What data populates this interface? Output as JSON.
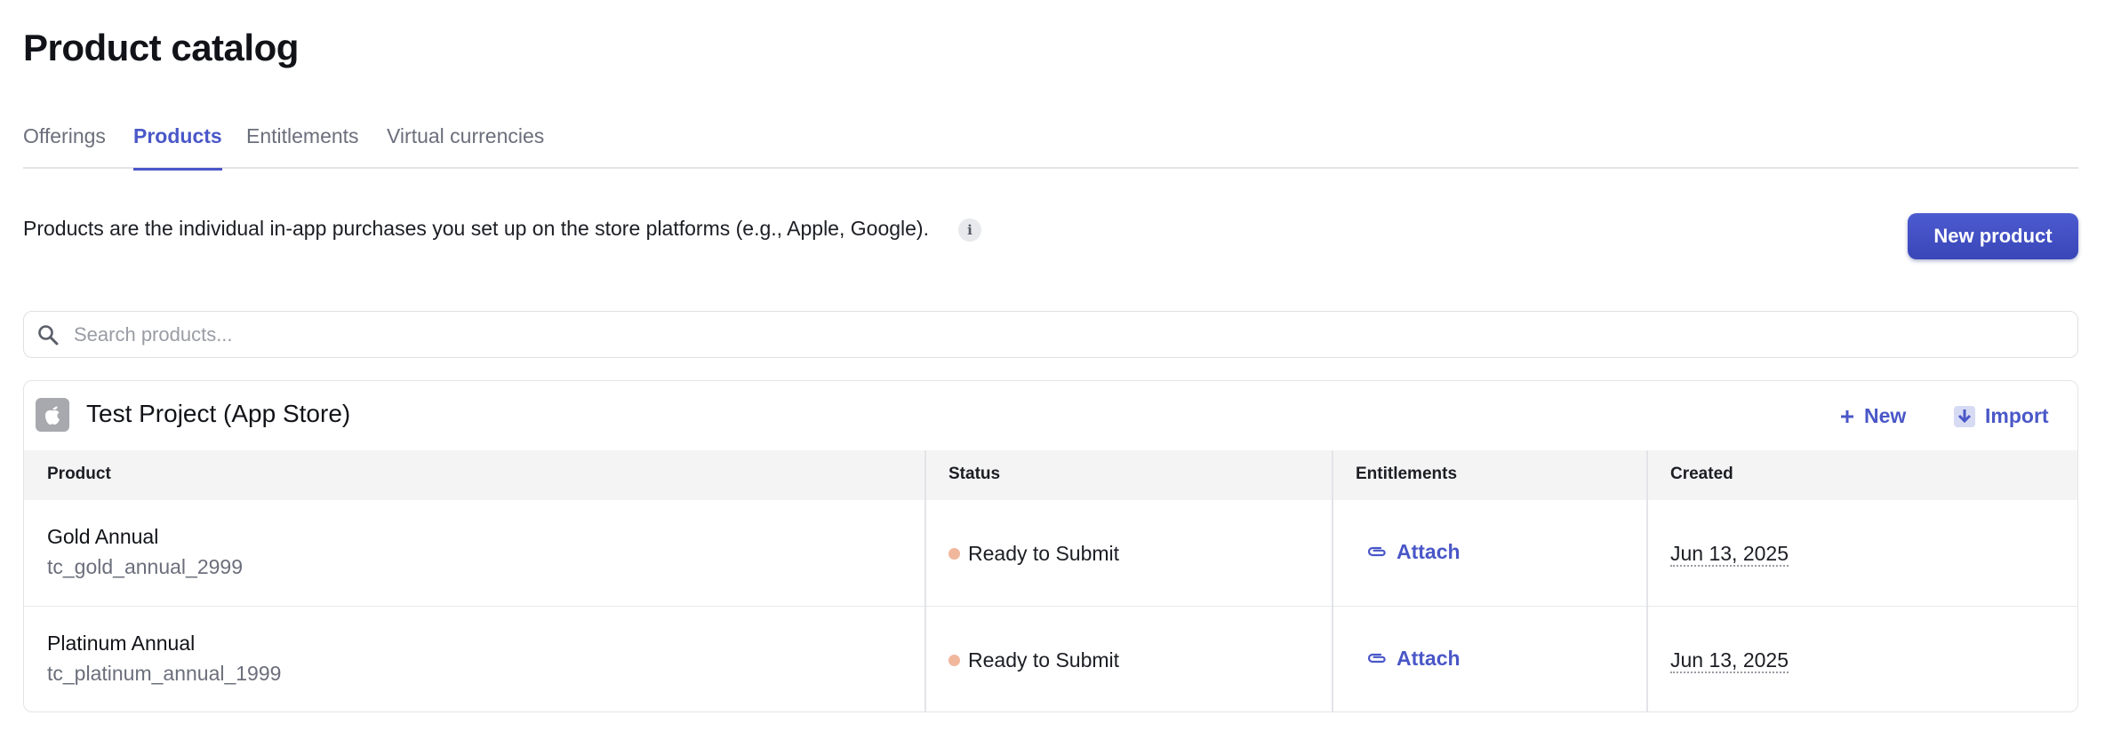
{
  "page": {
    "title": "Product catalog"
  },
  "tabs": [
    {
      "label": "Offerings",
      "active": false
    },
    {
      "label": "Products",
      "active": true
    },
    {
      "label": "Entitlements",
      "active": false
    },
    {
      "label": "Virtual currencies",
      "active": false
    }
  ],
  "description": "Products are the individual in-app purchases you set up on the store platforms (e.g., Apple, Google).",
  "info_icon": "i",
  "new_product_label": "New product",
  "search": {
    "placeholder": "Search products...",
    "value": ""
  },
  "project": {
    "title": "Test Project (App Store)",
    "store_icon": "apple-icon",
    "new_label": "New",
    "import_label": "Import",
    "columns": [
      "Product",
      "Status",
      "Entitlements",
      "Created"
    ],
    "rows": [
      {
        "name": "Gold Annual",
        "id": "tc_gold_annual_2999",
        "status": "Ready to Submit",
        "entitlements": "Attach",
        "created": "Jun 13, 2025"
      },
      {
        "name": "Platinum Annual",
        "id": "tc_platinum_annual_1999",
        "status": "Ready to Submit",
        "entitlements": "Attach",
        "created": "Jun 13, 2025"
      }
    ]
  },
  "colors": {
    "accent": "#4a57c8",
    "status_ready": "#f0b79c",
    "header_bg": "#f4f4f5"
  }
}
